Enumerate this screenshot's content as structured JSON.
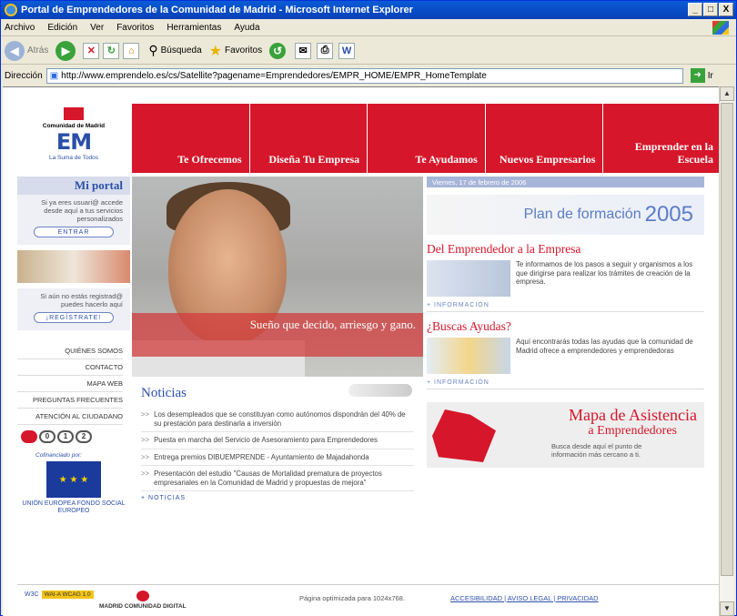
{
  "window": {
    "title": "Portal de Emprendedores de la Comunidad de Madrid - Microsoft Internet Explorer",
    "controls": [
      "_",
      "□",
      "X"
    ]
  },
  "menu": [
    "Archivo",
    "Edición",
    "Ver",
    "Favoritos",
    "Herramientas",
    "Ayuda"
  ],
  "toolbar": {
    "back": "Atrás",
    "search": "Búsqueda",
    "favorites": "Favoritos"
  },
  "address": {
    "label": "Dirección",
    "url": "http://www.emprendelo.es/cs/Satellite?pagename=Emprendedores/EMPR_HOME/EMPR_HomeTemplate",
    "go": "Ir"
  },
  "logo": {
    "region": "Comunidad de Madrid",
    "mark": "EM",
    "tagline": "La Suma de Todos"
  },
  "nav": [
    "Te Ofrecemos",
    "Diseña Tu Empresa",
    "Te Ayudamos",
    "Nuevos Empresarios",
    "Emprender en la Escuela"
  ],
  "sidebar": {
    "portal_title": "Mi portal",
    "portal_text": "Si ya eres usuari@ accede desde aquí a tus servicios personalizados",
    "enter": "ENTRAR",
    "register_text": "Si aún no estás registrad@ puedes hacerlo aquí",
    "register": "¡REGÍSTRATE!",
    "links": [
      "QUIÉNES SOMOS",
      "CONTACTO",
      "MAPA WEB",
      "PREGUNTAS FRECUENTES",
      "ATENCIÓN AL CIUDADANO"
    ],
    "cofin": "Cofinanciado por:",
    "eu": "UNIÓN EUROPEA FONDO SOCIAL EUROPEO"
  },
  "hero": {
    "quote": "Sueño que decido, arriesgo y gano."
  },
  "news": {
    "title": "Noticias",
    "items": [
      "Los desempleados que se constituyan como autónomos dispondrán del 40% de su prestación para destinarla a inversión",
      "Puesta en marcha del Servicio de Asesoramiento para Emprendedores",
      "Entrega premios DIBUEMPRENDE - Ayuntamiento de Majadahonda",
      "Presentación del estudio \"Causas de Mortalidad prematura de proyectos empresariales en la Comunidad de Madrid y propuestas de mejora\""
    ],
    "more": "+ NOTICIAS"
  },
  "right": {
    "date": "Viernes, 17 de febrero de 2006",
    "plan": "Plan de formación",
    "plan_year": "2005",
    "sec1_title": "Del Emprendedor a la Empresa",
    "sec1_text": "Te informamos de los pasos a seguir y organismos a los que dirigirse para realizar los trámites de creación de la empresa.",
    "sec1_more": "+ INFORMACIÓN",
    "sec2_title": "¿Buscas Ayudas?",
    "sec2_text": "Aquí encontrarás todas las ayudas que la comunidad de Madrid ofrece a emprendedores y emprendedoras",
    "sec2_more": "+ INFORMACIÓN",
    "mapa_t1": "Mapa de Asistencia",
    "mapa_t2": "a Emprendedores",
    "mapa_t3": "Busca desde aquí el punto de información más cercano a ti."
  },
  "footer": {
    "wai": "WAI-A WCAG 1.0",
    "w3c": "W3C",
    "mdig": "MADRID COMUNIDAD DIGITAL",
    "opt": "Página optimizada para 1024x768.",
    "legal": "ACCESIBILIDAD | AVISO LEGAL | PRIVACIDAD"
  },
  "colors": {
    "brand_red": "#d6162a",
    "brand_blue": "#2b4fa8"
  }
}
